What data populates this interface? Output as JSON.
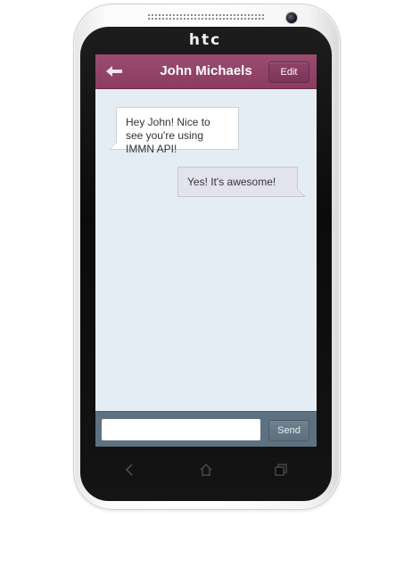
{
  "device": {
    "brand": "htc"
  },
  "header": {
    "title": "John Michaels",
    "back_icon": "back-arrow-icon",
    "edit_label": "Edit"
  },
  "messages": [
    {
      "direction": "incoming",
      "text": "Hey John! Nice to see you're using IMMN API!"
    },
    {
      "direction": "outgoing",
      "text": "Yes! It's awesome!"
    }
  ],
  "compose": {
    "value": "",
    "send_label": "Send"
  },
  "nav_buttons": [
    "back-icon",
    "home-icon",
    "recent-apps-icon"
  ],
  "colors": {
    "header": "#8f4368",
    "chat_background": "#e5edf4",
    "compose_bar": "#5d7180",
    "incoming_bubble": "#ffffff",
    "outgoing_bubble": "#e3e3ef"
  }
}
